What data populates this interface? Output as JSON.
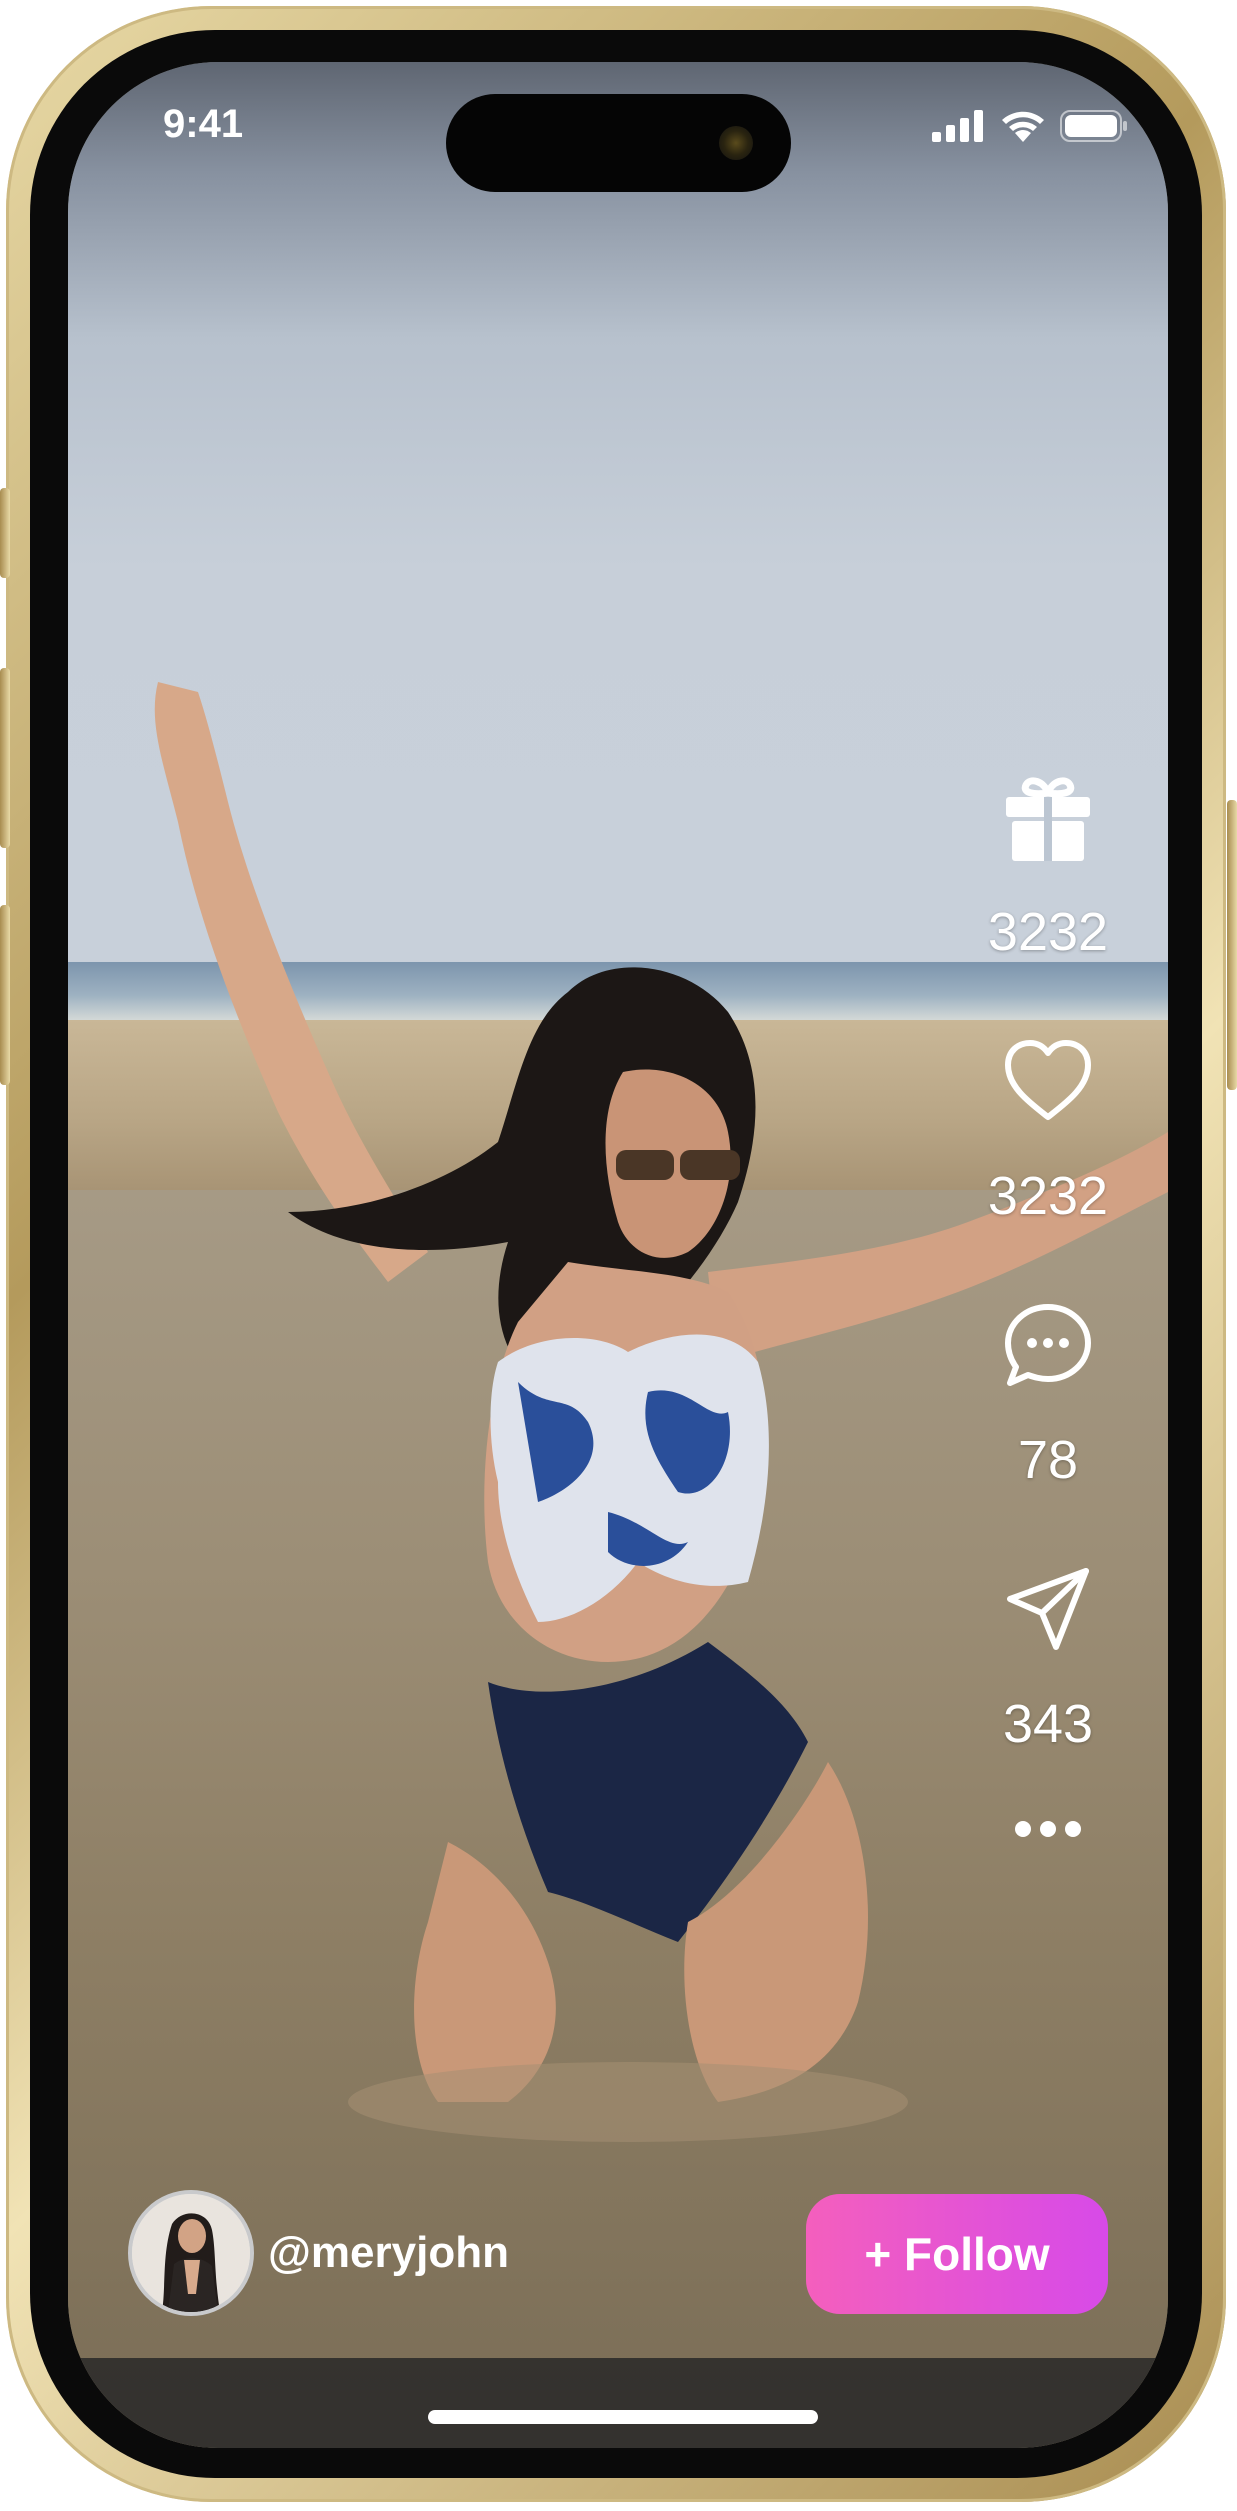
{
  "status_bar": {
    "time": "9:41",
    "signal_icon": "cellular-signal-icon",
    "wifi_icon": "wifi-icon",
    "battery_icon": "battery-icon"
  },
  "actions": [
    {
      "name": "gift",
      "icon": "gift-icon",
      "count": "3232"
    },
    {
      "name": "like",
      "icon": "heart-icon",
      "count": "3232"
    },
    {
      "name": "comment",
      "icon": "comment-bubble-icon",
      "count": "78"
    },
    {
      "name": "share",
      "icon": "send-icon",
      "count": "343"
    }
  ],
  "more_icon": "more-dots-icon",
  "user": {
    "handle": "@meryjohn"
  },
  "follow_button": {
    "label": "+ Follow",
    "gradient_start": "#f45fbd",
    "gradient_end": "#d74ae8"
  }
}
